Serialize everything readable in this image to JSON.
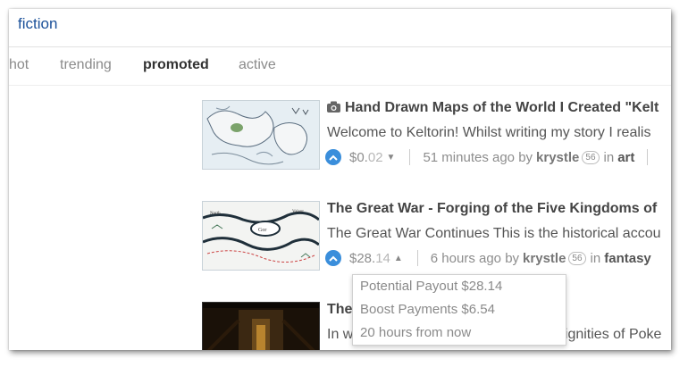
{
  "header": {
    "tag": "fiction"
  },
  "tabs": [
    {
      "label": "hot",
      "active": false
    },
    {
      "label": "trending",
      "active": false
    },
    {
      "label": "promoted",
      "active": true
    },
    {
      "label": "active",
      "active": false
    }
  ],
  "posts": [
    {
      "title": "Hand Drawn Maps of the World I Created \"Kelt",
      "body": "Welcome to Keltorin! Whilst writing my story I realis",
      "payout_main": "$0.",
      "payout_cents": "02",
      "time": "51 minutes ago by",
      "author": "krystle",
      "reputation": "56",
      "in_label": "in",
      "category": "art"
    },
    {
      "title": "The Great War - Forging of the Five Kingdoms of",
      "body": "The Great War Continues This is the historical accou",
      "payout_main": "$28.",
      "payout_cents": "14",
      "time": "6 hours ago by",
      "author": "krystle",
      "reputation": "56",
      "in_label": "in",
      "category": "fantasy"
    },
    {
      "title": "The",
      "body": "In w",
      "body_tail": "dignities of Poke"
    }
  ],
  "payout_dropdown": {
    "potential": "Potential Payout $28.14",
    "boost": "Boost Payments $6.54",
    "eta": "20 hours from now"
  },
  "colors": {
    "accent": "#3a8edb",
    "link": "#1a5099"
  }
}
